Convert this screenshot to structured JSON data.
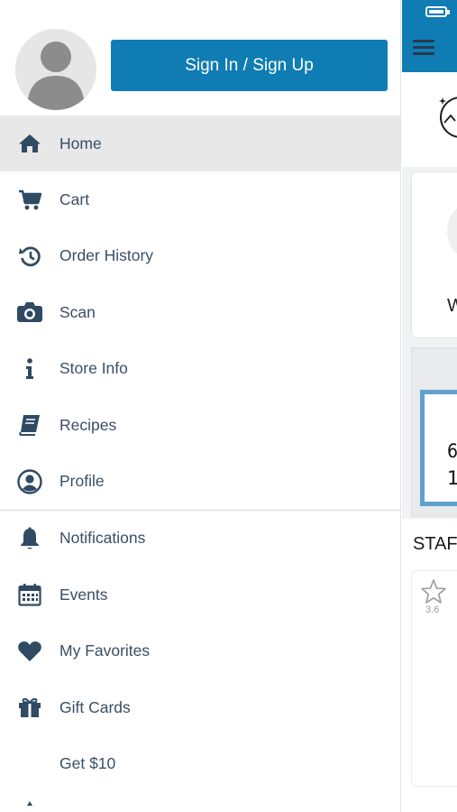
{
  "drawer": {
    "signin_label": "Sign In / Sign Up",
    "items_primary": [
      {
        "label": "Home",
        "icon": "home-icon",
        "active": true
      },
      {
        "label": "Cart",
        "icon": "cart-icon"
      },
      {
        "label": "Order History",
        "icon": "history-icon"
      },
      {
        "label": "Scan",
        "icon": "camera-icon"
      },
      {
        "label": "Store Info",
        "icon": "info-icon"
      },
      {
        "label": "Recipes",
        "icon": "book-icon"
      },
      {
        "label": "Profile",
        "icon": "user-circle-icon"
      }
    ],
    "items_secondary": [
      {
        "label": "Notifications",
        "icon": "bell-icon"
      },
      {
        "label": "Events",
        "icon": "calendar-icon"
      },
      {
        "label": "My Favorites",
        "icon": "heart-icon"
      },
      {
        "label": "Gift Cards",
        "icon": "gift-icon"
      },
      {
        "label": "Get $10",
        "icon": ""
      }
    ]
  },
  "app": {
    "card_letter": "W",
    "frame_line1": "6",
    "frame_line2": "1",
    "section_title": "STAF",
    "rating": "3.6"
  },
  "colors": {
    "accent": "#0f7db3",
    "active_row": "#e8e8e8",
    "icon": "#2f4a63",
    "frame": "#5ea1cc"
  }
}
